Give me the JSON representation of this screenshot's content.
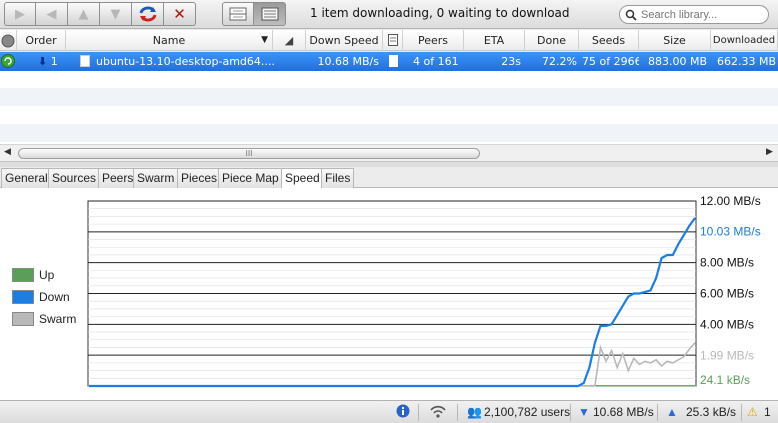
{
  "toolbar": {
    "buttons": [
      "play-icon",
      "back-icon",
      "up-icon",
      "down-icon",
      "refresh-icon",
      "stop-icon"
    ],
    "status_text": "1 item downloading, 0 waiting to download",
    "search_placeholder": "Search library..."
  },
  "table": {
    "headers": {
      "order": "Order",
      "name": "Name",
      "down_speed": "Down Speed",
      "peers": "Peers",
      "eta": "ETA",
      "done": "Done",
      "seeds": "Seeds",
      "size": "Size",
      "downloaded": "Downloaded"
    },
    "rows": [
      {
        "order": "1",
        "name": "ubuntu-13.10-desktop-amd64....",
        "down_speed": "10.68 MB/s",
        "peers": "4 of 161",
        "eta": "23s",
        "done": "72.2%",
        "seeds": "75 of 2966",
        "size": "883.00 MB",
        "downloaded": "662.33 MB"
      }
    ]
  },
  "scroll_thumb_grip": "III",
  "tabs": [
    "General",
    "Sources",
    "Peers",
    "Swarm",
    "Pieces",
    "Piece Map",
    "Speed",
    "Files"
  ],
  "selected_tab": "Speed",
  "legend": {
    "up": "Up",
    "down": "Down",
    "swarm": "Swarm"
  },
  "colors": {
    "up": "#5a9e5a",
    "down": "#1a7ee6",
    "swarm": "#b9b9b9",
    "selection": "#2a7fe8"
  },
  "chart_data": {
    "type": "line",
    "ylim": [
      0,
      12
    ],
    "y_unit": "MB/s",
    "tick_labels": [
      "12.00 MB/s",
      "8.00 MB/s",
      "6.00 MB/s",
      "4.00 MB/s"
    ],
    "current_labels": {
      "down": "10.03 MB/s",
      "swarm": "1.99 MB/s",
      "up": "24.1 kB/s"
    },
    "series": [
      {
        "name": "Down",
        "values": [
          0,
          0,
          0,
          0,
          0,
          0,
          0,
          0,
          0,
          0,
          0,
          0,
          0,
          0,
          0,
          0,
          0,
          0,
          0,
          0,
          0,
          0,
          0,
          0,
          0,
          0,
          0,
          0,
          0,
          0,
          0,
          0,
          0,
          0,
          0,
          0,
          0,
          0,
          0,
          0,
          0,
          0,
          0,
          0,
          0,
          0,
          0,
          0,
          0,
          0,
          0,
          0,
          0,
          0,
          0,
          0,
          0,
          0,
          0,
          0,
          0,
          0,
          0,
          0,
          0,
          0,
          0,
          0,
          0,
          0,
          0,
          0,
          0,
          0,
          0,
          0,
          0,
          0,
          0,
          0,
          0,
          0,
          0,
          0,
          0,
          0,
          0,
          0,
          0,
          0.2,
          1.2,
          2.8,
          3.9,
          3.9,
          4.0,
          4.6,
          5.2,
          5.8,
          6.0,
          6.0,
          6.1,
          6.2,
          7.0,
          8.3,
          8.5,
          8.5,
          9.2,
          9.8,
          10.4,
          10.9
        ]
      },
      {
        "name": "Swarm",
        "values": [
          0,
          0,
          0,
          0,
          0,
          0,
          0,
          0,
          0,
          0,
          0,
          0,
          0,
          0,
          0,
          0,
          0,
          0,
          0,
          0,
          0,
          0,
          0,
          0,
          0,
          0,
          0,
          0,
          0,
          0,
          0,
          0,
          0,
          0,
          0,
          0,
          0,
          0,
          0,
          0,
          0,
          0,
          0,
          0,
          0,
          0,
          0,
          0,
          0,
          0,
          0,
          0,
          0,
          0,
          0,
          0,
          0,
          0,
          0,
          0,
          0,
          0,
          0,
          0,
          0,
          0,
          0,
          0,
          0,
          0,
          0,
          0,
          0,
          0,
          0,
          0,
          0,
          0,
          0,
          0,
          0,
          0,
          0,
          0,
          0,
          0,
          0,
          0,
          0,
          0,
          0,
          0,
          2.5,
          1.6,
          2.3,
          1.2,
          2.1,
          1.0,
          1.8,
          1.4,
          1.6,
          1.5,
          1.7,
          1.3,
          1.6,
          1.5,
          1.7,
          1.9,
          2.4,
          2.8
        ]
      },
      {
        "name": "Up",
        "values": [
          0.02,
          0.02,
          0.02,
          0.02,
          0.02,
          0.02,
          0.02,
          0.02,
          0.02,
          0.02,
          0.02,
          0.02,
          0.02,
          0.02,
          0.02,
          0.02,
          0.02,
          0.02,
          0.02,
          0.02,
          0.02,
          0.02,
          0.02,
          0.02,
          0.02,
          0.02,
          0.02,
          0.02,
          0.02,
          0.02,
          0.02,
          0.02,
          0.02,
          0.02,
          0.02,
          0.02,
          0.02,
          0.02,
          0.02,
          0.02,
          0.02,
          0.02,
          0.02,
          0.02,
          0.02,
          0.02,
          0.02,
          0.02,
          0.02,
          0.02,
          0.02,
          0.02,
          0.02,
          0.02,
          0.02,
          0.02,
          0.02,
          0.02,
          0.02,
          0.02,
          0.02,
          0.02,
          0.02,
          0.02,
          0.02,
          0.02,
          0.02,
          0.02,
          0.02,
          0.02,
          0.02,
          0.02,
          0.02,
          0.02,
          0.02,
          0.02,
          0.02,
          0.02,
          0.02,
          0.02,
          0.02,
          0.02,
          0.02,
          0.02,
          0.02,
          0.02,
          0.02,
          0.02,
          0.02,
          0.02,
          0.02,
          0.02,
          0.02,
          0.02,
          0.02,
          0.02,
          0.02,
          0.02,
          0.02,
          0.02,
          0.02,
          0.02,
          0.02,
          0.02,
          0.02,
          0.02,
          0.02,
          0.02,
          0.02,
          0.02
        ]
      }
    ]
  },
  "statusbar": {
    "users": "2,100,782 users",
    "down": "10.68 MB/s",
    "up": "25.3 kB/s",
    "alerts": "1"
  }
}
